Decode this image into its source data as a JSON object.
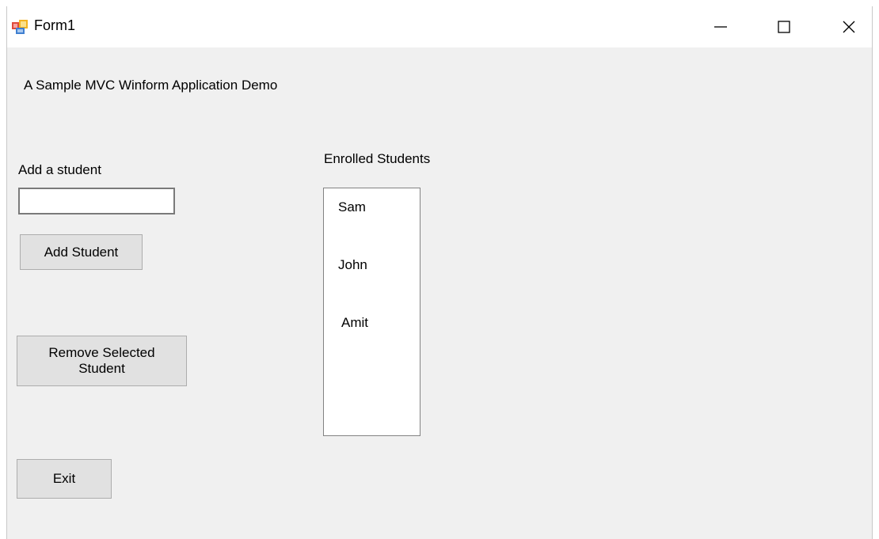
{
  "window": {
    "title": "Form1",
    "icon": "winforms-app-icon",
    "controls": {
      "minimize": "minimize-icon",
      "maximize": "maximize-icon",
      "close": "close-icon"
    }
  },
  "form": {
    "heading": "A Sample MVC Winform Application Demo",
    "add_label": "Add a student",
    "student_input": {
      "value": "",
      "placeholder": ""
    },
    "add_button": "Add Student",
    "remove_button": "Remove Selected\nStudent",
    "exit_button": "Exit",
    "enrolled_label": "Enrolled Students",
    "enrolled_students": [
      "Sam",
      "John",
      "Amit"
    ]
  },
  "colors": {
    "window_background": "#f0f0f0",
    "titlebar_background": "#ffffff",
    "button_face": "#e1e1e1"
  }
}
